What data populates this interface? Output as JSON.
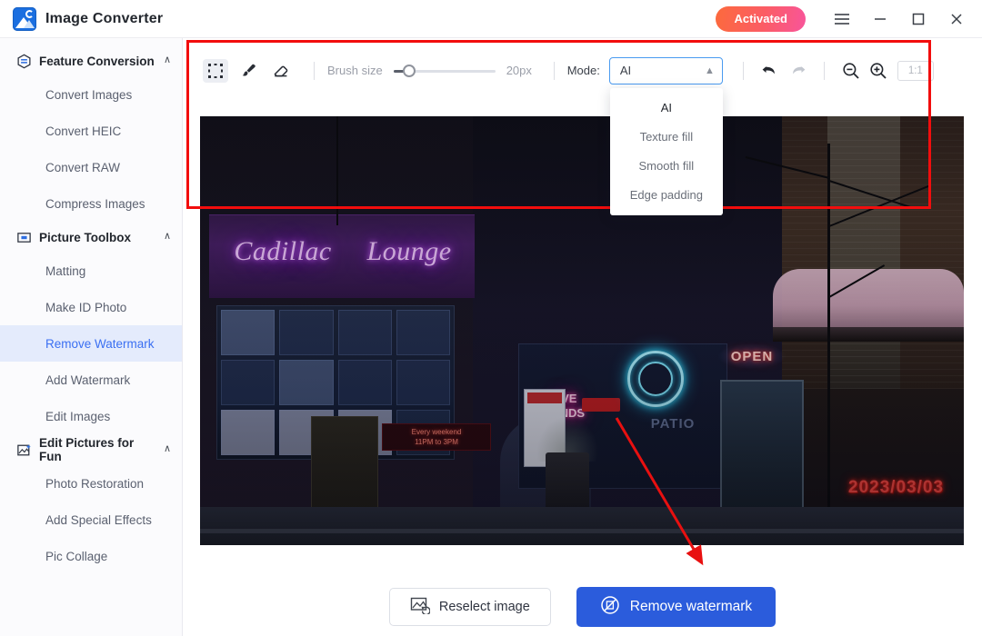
{
  "window": {
    "title": "Image Converter",
    "logo_icon": "image-converter-logo",
    "activated_label": "Activated",
    "menu_icon": "hamburger-menu-icon",
    "minimize_icon": "minimize-icon",
    "maximize_icon": "maximize-icon",
    "close_icon": "close-icon"
  },
  "sidebar": {
    "sections": [
      {
        "label": "Feature Conversion",
        "icon": "hexagon-convert-icon",
        "chevron": "∧",
        "items": [
          {
            "label": "Convert Images",
            "active": false
          },
          {
            "label": "Convert HEIC",
            "active": false
          },
          {
            "label": "Convert RAW",
            "active": false
          },
          {
            "label": "Compress Images",
            "active": false
          }
        ]
      },
      {
        "label": "Picture Toolbox",
        "icon": "picture-toolbox-icon",
        "chevron": "∧",
        "items": [
          {
            "label": "Matting",
            "active": false
          },
          {
            "label": "Make ID Photo",
            "active": false
          },
          {
            "label": "Remove Watermark",
            "active": true
          },
          {
            "label": "Add Watermark",
            "active": false
          },
          {
            "label": "Edit Images",
            "active": false
          }
        ]
      },
      {
        "label": "Edit Pictures for Fun",
        "icon": "edit-pictures-fun-icon",
        "chevron": "∧",
        "items": [
          {
            "label": "Photo Restoration",
            "active": false
          },
          {
            "label": "Add Special Effects",
            "active": false
          },
          {
            "label": "Pic Collage",
            "active": false
          }
        ]
      }
    ]
  },
  "toolbar": {
    "tools": [
      {
        "name": "marquee-select-tool",
        "selected": true
      },
      {
        "name": "brush-tool",
        "selected": false
      },
      {
        "name": "eraser-tool",
        "selected": false
      }
    ],
    "brush_size_label": "Brush size",
    "brush_size_value": "20px",
    "mode_label": "Mode:",
    "mode_selected": "AI",
    "mode_options": [
      "AI",
      "Texture fill",
      "Smooth fill",
      "Edge padding"
    ],
    "undo_icon": "undo-arrow-icon",
    "redo_icon": "redo-arrow-icon",
    "zoom_out_icon": "zoom-out-icon",
    "zoom_in_icon": "zoom-in-icon",
    "zoom_ratio": "1:1"
  },
  "canvas": {
    "photo": {
      "description": "night storefront photo",
      "neon_sign_word1": "Cadillac",
      "neon_sign_word2": "Lounge",
      "led_line1": "Every weekend",
      "led_line2": "11PM to 3PM",
      "live_line1": "LIVE",
      "live_line2": "BANDS",
      "open_sign": "OPEN",
      "patio_text": "PATIO",
      "watermark_text": "2023/03/03"
    }
  },
  "annotations": {
    "rect_color": "#f20d0d",
    "arrow_color": "#e81010"
  },
  "footer": {
    "reselect_label": "Reselect image",
    "reselect_icon": "reselect-image-icon",
    "remove_label": "Remove watermark",
    "remove_icon": "remove-watermark-icon"
  },
  "colors": {
    "accent_blue": "#2b5cdc",
    "active_nav": "#3a6ff2",
    "active_nav_bg": "#e4ebfc",
    "annotation_red": "#f20d0d"
  }
}
